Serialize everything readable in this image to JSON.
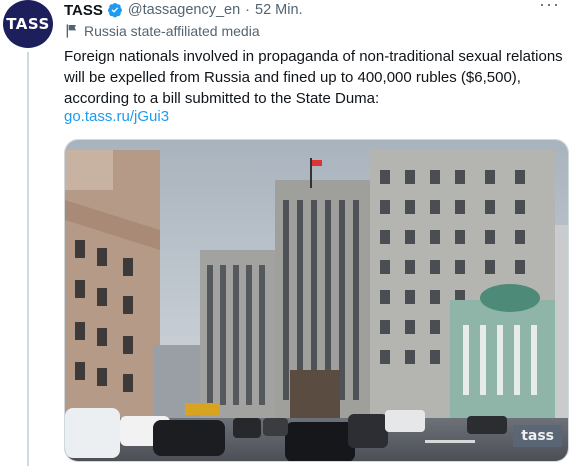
{
  "tweet": {
    "avatar_text": "TASS",
    "author_name": "TASS",
    "handle": "@tassagency_en",
    "separator": "·",
    "time": "52 Min.",
    "more_label": "···",
    "affiliation_label": "Russia state-affiliated media",
    "text": "Foreign nationals involved in propaganda of non-traditional sexual relations will be expelled from Russia and fined up to 400,000 rubles ($6,500), according to a bill submitted to the State Duma:",
    "link": "go.tass.ru/jGui3",
    "media_watermark": "tass"
  },
  "colors": {
    "verified_badge": "#1d9bf0",
    "link": "#1d9bf0",
    "avatar_bg": "#1d1f5c"
  },
  "icons": {
    "verified": "verified-badge-icon",
    "affiliation": "flag-icon",
    "more": "more-options-icon"
  }
}
